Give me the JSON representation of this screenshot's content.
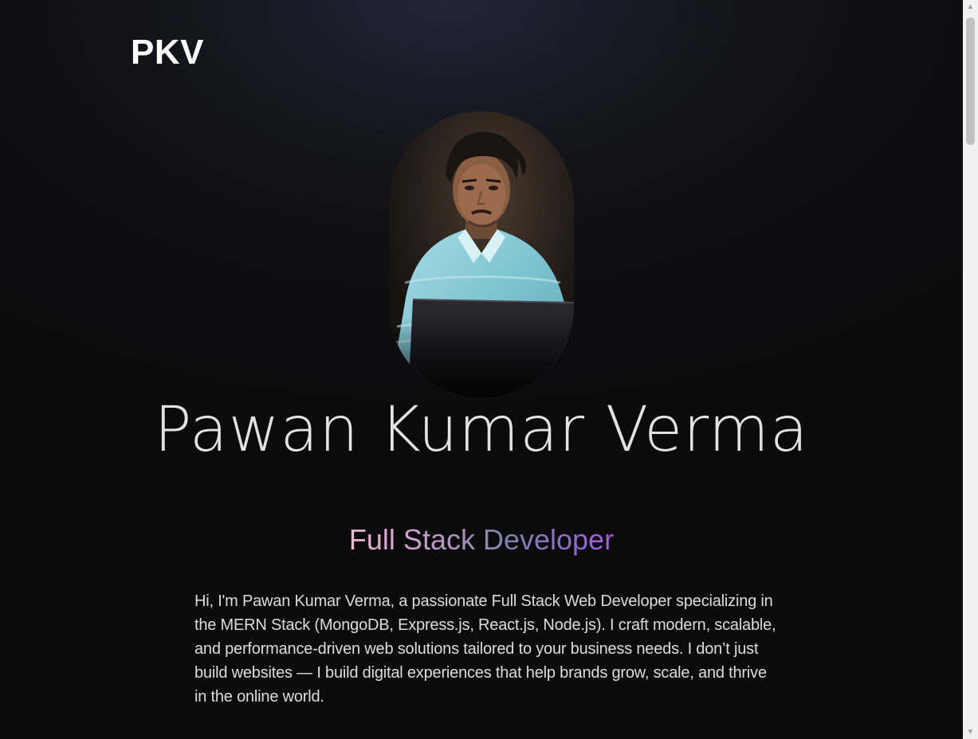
{
  "header": {
    "logo": "PKV"
  },
  "hero": {
    "portrait_alt": "Portrait of Pawan Kumar Verma",
    "name": "Pawan Kumar Verma",
    "role": "Full Stack Developer",
    "bio": "Hi, I'm Pawan Kumar Verma, a passionate Full Stack Web Developer specializing in the MERN Stack (MongoDB, Express.js, React.js, Node.js). I craft modern, scalable, and performance-driven web solutions tailored to your business needs. I don’t just build websites — I build digital experiences that help brands grow, scale, and thrive in the online world."
  },
  "colors": {
    "background": "#0b0b0c",
    "role_gradient_start": "#f2b7d8",
    "role_gradient_end": "#a25ae0"
  },
  "icons": {
    "scroll_up": "triangle-up",
    "scroll_down": "triangle-down"
  }
}
